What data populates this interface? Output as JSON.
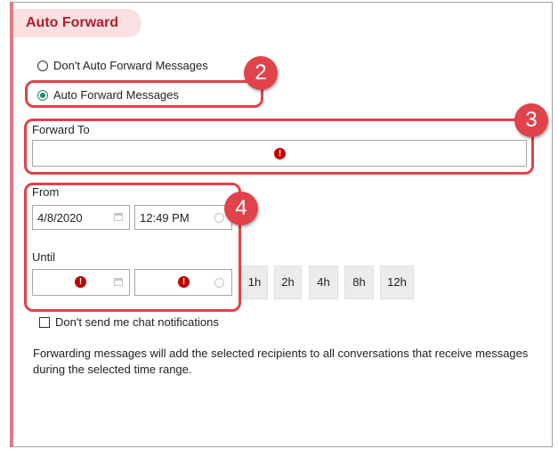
{
  "section": {
    "title": "Auto Forward"
  },
  "options": {
    "dont_forward": "Don't Auto Forward Messages",
    "forward": "Auto Forward Messages",
    "selected": "forward"
  },
  "forward_to": {
    "label": "Forward To",
    "value": ""
  },
  "from": {
    "label": "From",
    "date": "4/8/2020",
    "time": "12:49 PM"
  },
  "until": {
    "label": "Until",
    "date": "",
    "time": ""
  },
  "durations": [
    "1h",
    "2h",
    "4h",
    "8h",
    "12h"
  ],
  "notifications": {
    "label": "Don't send me chat notifications",
    "checked": false
  },
  "note": "Forwarding messages will add the selected recipients to all conversations that receive messages during the selected time range.",
  "callouts": {
    "two": "2",
    "three": "3",
    "four": "4"
  },
  "colors": {
    "callout": "#e0434a",
    "error": "#c00000",
    "accent": "#1d8a6a",
    "title": "#b0202c"
  }
}
